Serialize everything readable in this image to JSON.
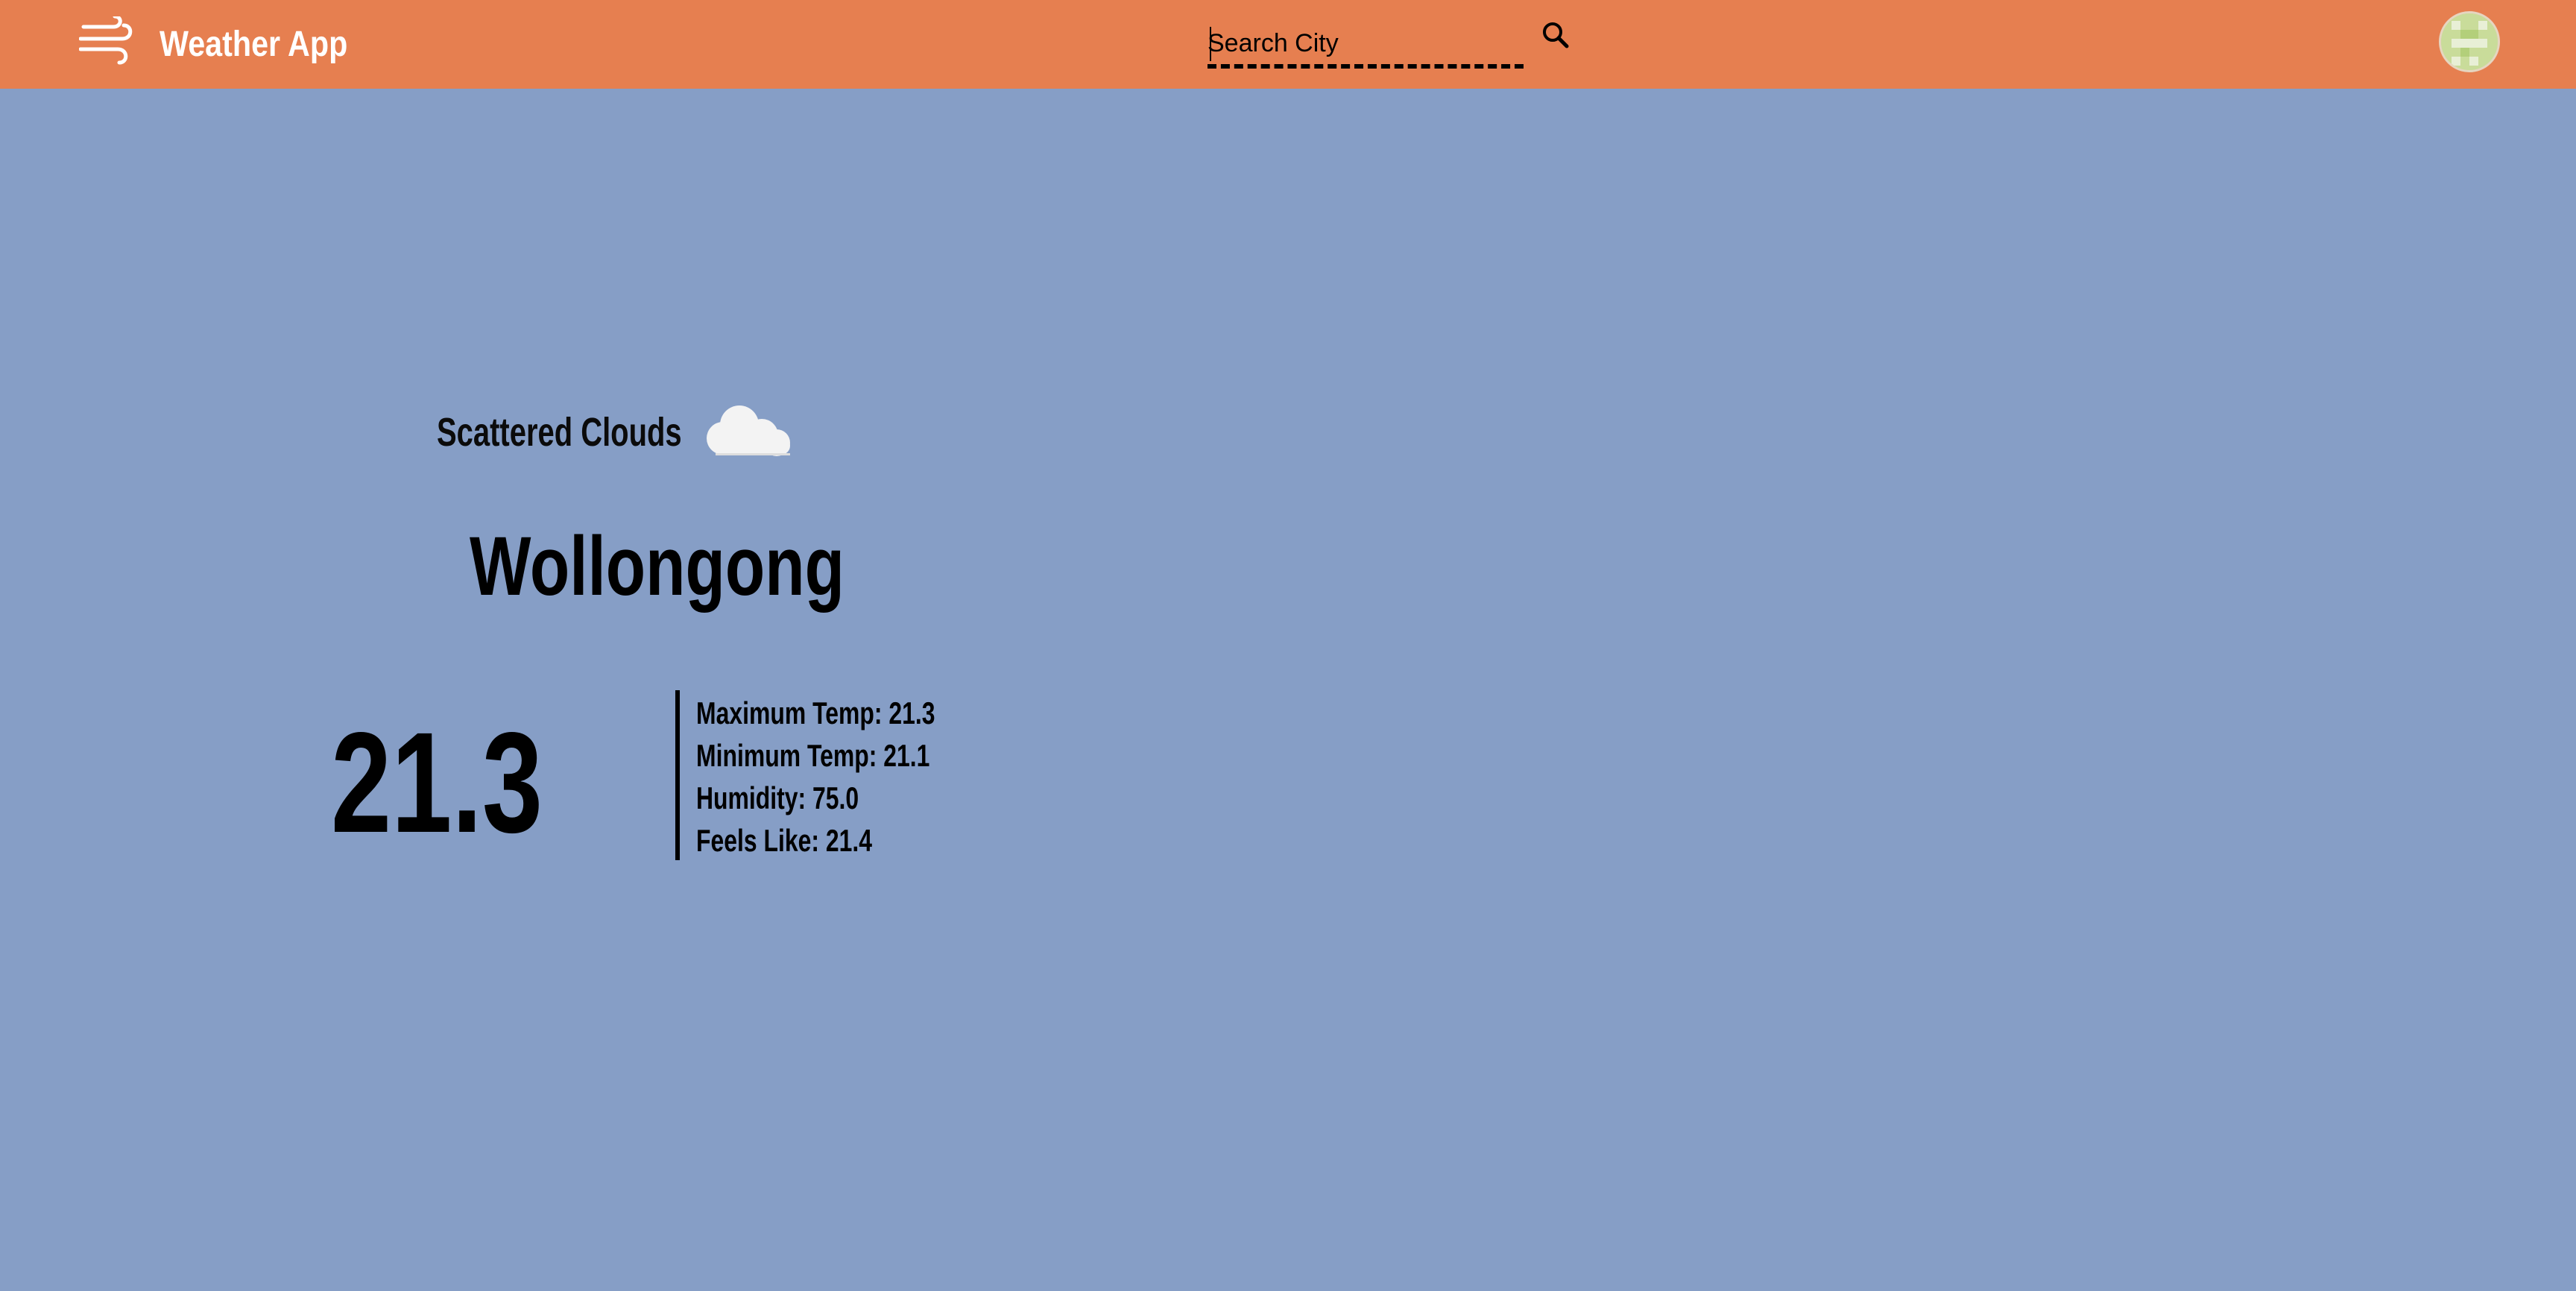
{
  "header": {
    "app_title": "Weather App",
    "menu_icon": "wind-icon",
    "search": {
      "placeholder": "Search City",
      "value": "",
      "button_icon": "search-icon"
    },
    "avatar_icon": "avatar"
  },
  "weather": {
    "condition": "Scattered Clouds",
    "condition_icon": "cloud-icon",
    "city": "Wollongong",
    "temperature": "21.3",
    "details": {
      "max_temp": "Maximum Temp: 21.3",
      "min_temp": "Minimum Temp: 21.1",
      "humidity": "Humidity: 75.0",
      "feels_like": "Feels Like: 21.4"
    }
  },
  "colors": {
    "header_bg": "#e67f50",
    "page_bg": "#869ec6",
    "text": "#000000",
    "header_text": "#ffffff"
  }
}
